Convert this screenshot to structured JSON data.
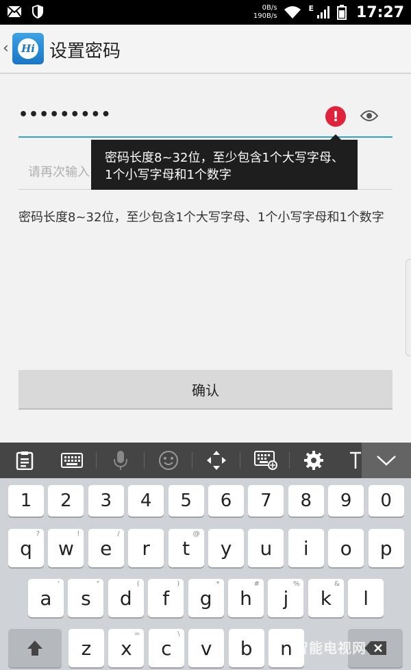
{
  "status_bar": {
    "speed_up": "0B/s",
    "speed_down": "190B/s",
    "network": "E",
    "time": "17:27",
    "icons": [
      "mail-icon",
      "shield-icon",
      "wifi-icon",
      "signal-icon",
      "battery-icon"
    ]
  },
  "app_bar": {
    "logo_text": "Hi",
    "title": "设置密码"
  },
  "form": {
    "password_value": "•••••••••",
    "confirm_placeholder": "请再次输入",
    "error_tooltip": "密码长度8~32位，至少包含1个大写字母、1个小写字母和1个数字",
    "hint": "密码长度8~32位，至少包含1个大写字母、1个小写字母和1个数字",
    "confirm_button": "确认"
  },
  "keyboard": {
    "toolbar": [
      "clipboard-icon",
      "keyboard-icon",
      "mic-icon",
      "emoji-icon",
      "cursor-move-icon",
      "keyboard-settings-icon",
      "gear-icon",
      "text-icon",
      "collapse-icon"
    ],
    "row_numbers": [
      "1",
      "2",
      "3",
      "4",
      "5",
      "6",
      "7",
      "8",
      "9",
      "0"
    ],
    "row1": [
      {
        "key": "q",
        "sub": "?"
      },
      {
        "key": "w",
        "sub": "!"
      },
      {
        "key": "e",
        "sub": "/"
      },
      {
        "key": "r",
        "sub": ""
      },
      {
        "key": "t",
        "sub": "@"
      },
      {
        "key": "y",
        "sub": ""
      },
      {
        "key": "u",
        "sub": ""
      },
      {
        "key": "i",
        "sub": ""
      },
      {
        "key": "o",
        "sub": ""
      },
      {
        "key": "p",
        "sub": ""
      }
    ],
    "row2": [
      {
        "key": "a",
        "sub": "'"
      },
      {
        "key": "s",
        "sub": "\""
      },
      {
        "key": "d",
        "sub": "("
      },
      {
        "key": "f",
        "sub": ")"
      },
      {
        "key": "g",
        "sub": "*"
      },
      {
        "key": "h",
        "sub": "#"
      },
      {
        "key": "j",
        "sub": "%"
      },
      {
        "key": "k",
        "sub": "&"
      },
      {
        "key": "l",
        "sub": ""
      }
    ],
    "row3": [
      {
        "key": "z",
        "sub": ""
      },
      {
        "key": "x",
        "sub": "="
      },
      {
        "key": "c",
        "sub": "\\"
      },
      {
        "key": "v",
        "sub": ""
      },
      {
        "key": "b",
        "sub": ""
      },
      {
        "key": "n",
        "sub": ""
      }
    ],
    "watermark": "智能电视网"
  }
}
